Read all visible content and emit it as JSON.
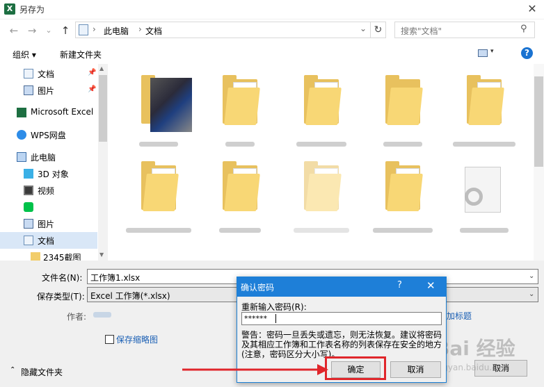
{
  "window": {
    "title": "另存为",
    "app_icon": "X",
    "close": "✕"
  },
  "address": {
    "back": "←",
    "forward": "→",
    "recent": "⌄",
    "up": "↑",
    "crumbs": [
      "此电脑",
      "文档"
    ],
    "sep": "›",
    "dropdown": "⌄",
    "refresh": "↻",
    "search_placeholder": "搜索\"文档\"",
    "search_icon": "⚲"
  },
  "toolbar": {
    "organize": "组织 ▾",
    "new_folder": "新建文件夹",
    "view_dd": "▾",
    "help": "?"
  },
  "nav": {
    "items": [
      {
        "label": "文档",
        "icon": "document-icon",
        "pinned": true
      },
      {
        "label": "图片",
        "icon": "picture-icon",
        "pinned": true
      },
      {
        "label": "Microsoft Excel",
        "icon": "excel-icon"
      },
      {
        "label": "WPS网盘",
        "icon": "cloud-icon"
      },
      {
        "label": "此电脑",
        "icon": "computer-icon"
      },
      {
        "label": "3D 对象",
        "icon": "cube-icon"
      },
      {
        "label": "视频",
        "icon": "video-icon"
      },
      {
        "label": "",
        "icon": "iqiyi-icon"
      },
      {
        "label": "图片",
        "icon": "picture-icon"
      },
      {
        "label": "文档",
        "icon": "document-icon",
        "selected": true
      },
      {
        "label": "2345截图",
        "icon": "folder-icon"
      }
    ],
    "pin_glyph": "📌"
  },
  "grid": {
    "tiles": [
      {
        "kind": "thumb"
      },
      {
        "kind": "folder"
      },
      {
        "kind": "folder"
      },
      {
        "kind": "folder"
      },
      {
        "kind": "folder"
      },
      {
        "kind": "folder"
      },
      {
        "kind": "folder"
      },
      {
        "kind": "folder-faded"
      },
      {
        "kind": "folder"
      },
      {
        "kind": "file"
      }
    ]
  },
  "form": {
    "filename_label": "文件名(N):",
    "filename_value": "工作簿1.xlsx",
    "type_label": "保存类型(T):",
    "type_value": "Excel 工作簿(*.xlsx)",
    "author_label": "作者:",
    "add_tag": "加标题",
    "thumbnail_label": "保存缩略图",
    "hide_folders": "隐藏文件夹",
    "hide_glyph": "⌃",
    "cancel": "取消"
  },
  "dialog": {
    "title": "确认密码",
    "help": "?",
    "close": "✕",
    "prompt": "重新输入密码(R):",
    "password": "******",
    "warning": "警告：密码一旦丢失或遗忘，则无法恢复。建议将密码及其相应工作簿和工作表名称的列表保存在安全的地方(注意，密码区分大小写)。",
    "ok": "确定",
    "cancel": "取消"
  },
  "watermark": {
    "text": "Bai 经验",
    "sub": "jingyan.baidu.com"
  },
  "colors": {
    "accent": "#1e7fd8",
    "highlight": "#e0262b",
    "folder": "#f8d775"
  }
}
